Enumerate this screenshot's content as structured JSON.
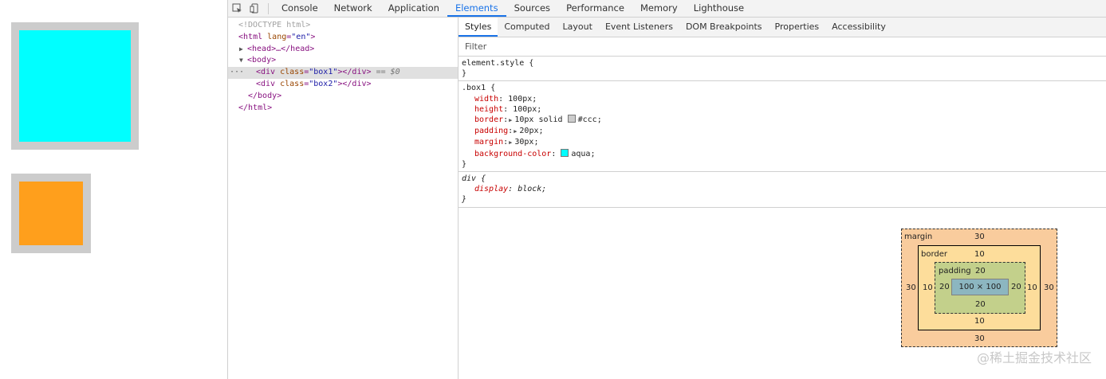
{
  "devtools": {
    "tabs": [
      "Console",
      "Network",
      "Application",
      "Elements",
      "Sources",
      "Performance",
      "Memory",
      "Lighthouse"
    ],
    "active_tab": "Elements",
    "dom": {
      "doctype": "<!DOCTYPE html>",
      "html_open_tag": "html",
      "html_lang_attr": "lang",
      "html_lang_val": "\"en\"",
      "head": "<head>…</head>",
      "body_open": "<body>",
      "div1_class_val": "\"box1\"",
      "div2_class_val": "\"box2\"",
      "class_attr": "class",
      "selected_marker": "== $0",
      "body_close": "</body>",
      "html_close": "</html>"
    },
    "subtabs": [
      "Styles",
      "Computed",
      "Layout",
      "Event Listeners",
      "DOM Breakpoints",
      "Properties",
      "Accessibility"
    ],
    "active_subtab": "Styles",
    "filter_placeholder": "Filter",
    "rules": {
      "element_style": {
        "selector": "element.style {",
        "close": "}"
      },
      "box1": {
        "selector": ".box1 {",
        "props": [
          {
            "name": "width",
            "value": "100px;"
          },
          {
            "name": "height",
            "value": "100px;"
          },
          {
            "name": "border",
            "value": "10px solid ",
            "swatch": "#cccccc",
            "after": "#ccc;"
          },
          {
            "name": "padding",
            "value": "20px;"
          },
          {
            "name": "margin",
            "value": "30px;"
          },
          {
            "name": "background-color",
            "value": "",
            "swatch": "#00ffff",
            "after": "aqua;"
          }
        ],
        "close": "}"
      },
      "div": {
        "selector": "div {",
        "props": [
          {
            "name": "display",
            "value": "block;"
          }
        ],
        "close": "}"
      }
    },
    "box_model": {
      "margin_label": "margin",
      "border_label": "border",
      "padding_label": "padding",
      "margin": {
        "top": "30",
        "right": "30",
        "bottom": "30",
        "left": "30"
      },
      "border": {
        "top": "10",
        "right": "10",
        "bottom": "10",
        "left": "10"
      },
      "padding": {
        "top": "20",
        "right": "20",
        "bottom": "20",
        "left": "20"
      },
      "content": "100 × 100"
    }
  },
  "page": {
    "box1_color": "#00ffff",
    "box2_color": "#ff9f1c",
    "border_color": "#cccccc"
  },
  "watermark": "@稀土掘金技术社区"
}
